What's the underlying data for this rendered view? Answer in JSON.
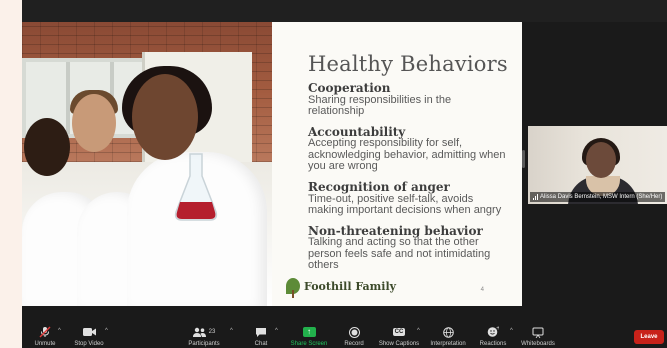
{
  "slide": {
    "title": "Healthy Behaviors",
    "sections": [
      {
        "heading": "Cooperation",
        "body": "Sharing responsibilities in the relationship"
      },
      {
        "heading": "Accountability",
        "body": "Accepting responsibility for self, acknowledging behavior, admitting when you are wrong"
      },
      {
        "heading": "Recognition of anger",
        "body": "Time-out, positive self-talk, avoids making important decisions when angry"
      },
      {
        "heading": "Non-threatening behavior",
        "body": "Talking and acting so that the other person feels safe and not intimidating others"
      }
    ],
    "brand": "Foothill Family",
    "page_number": "4"
  },
  "participant": {
    "name": "Alissa Davis Bernstein, MSW Intern (She/Her)"
  },
  "toolbar": {
    "unmute": "Unmute",
    "stop_video": "Stop Video",
    "participants": "Participants",
    "participants_count": "23",
    "chat": "Chat",
    "share_screen": "Share Screen",
    "record": "Record",
    "show_captions": "Show Captions",
    "captions_badge": "CC",
    "interpretation": "Interpretation",
    "reactions": "Reactions",
    "whiteboards": "Whiteboards",
    "leave": "Leave"
  },
  "colors": {
    "share_green": "#22b14c",
    "leave_red": "#c8221a",
    "background": "#1a1a1a"
  }
}
